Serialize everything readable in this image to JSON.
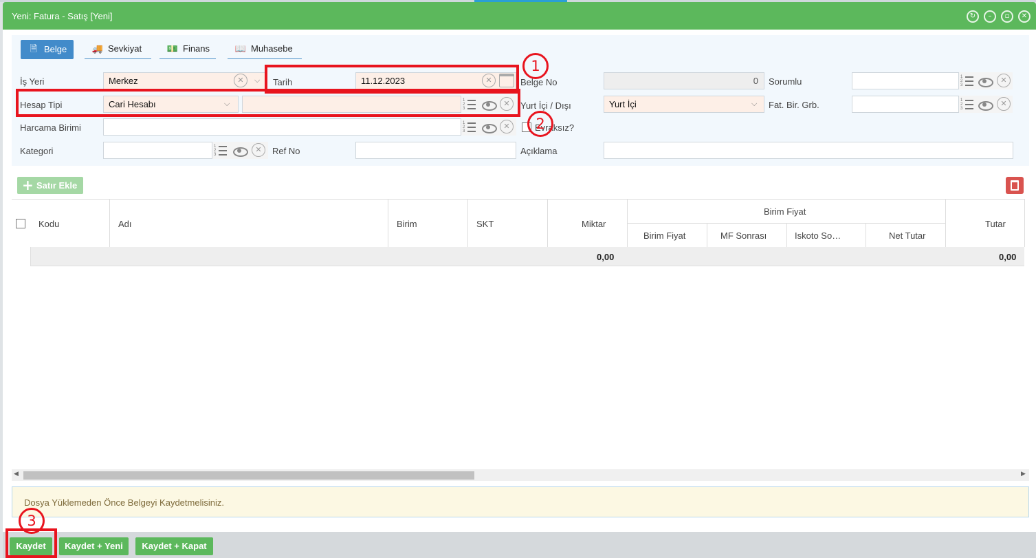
{
  "window": {
    "title": "Yeni: Fatura - Satış [Yeni]"
  },
  "tabs": [
    {
      "label": "Belge",
      "icon": "document-icon",
      "active": true
    },
    {
      "label": "Sevkiyat",
      "icon": "truck-icon"
    },
    {
      "label": "Finans",
      "icon": "money-icon"
    },
    {
      "label": "Muhasebe",
      "icon": "book-icon"
    }
  ],
  "form": {
    "is_yeri": {
      "label": "İş Yeri",
      "value": "Merkez"
    },
    "tarih": {
      "label": "Tarih",
      "value": "11.12.2023"
    },
    "belge_no": {
      "label": "Belge No",
      "value": "0"
    },
    "sorumlu": {
      "label": "Sorumlu",
      "value": ""
    },
    "hesap_tipi": {
      "label": "Hesap Tipi",
      "value": "Cari Hesabı"
    },
    "hesap": {
      "value": ""
    },
    "yurt": {
      "label": "Yurt İçi / Dışı",
      "value": "Yurt İçi"
    },
    "fat_bir_grb": {
      "label": "Fat. Bir. Grb.",
      "value": ""
    },
    "harcama_birimi": {
      "label": "Harcama Birimi",
      "value": ""
    },
    "evraksiz": {
      "label": "Evraksız?",
      "checked": false
    },
    "kategori": {
      "label": "Kategori",
      "value": ""
    },
    "ref_no": {
      "label": "Ref No",
      "value": ""
    },
    "aciklama": {
      "label": "Açıklama",
      "value": ""
    }
  },
  "grid": {
    "add_row_label": "Satır Ekle",
    "columns": {
      "kodu": "Kodu",
      "adi": "Adı",
      "birim": "Birim",
      "skt": "SKT",
      "miktar": "Miktar",
      "birim_fiyat_group": "Birim Fiyat",
      "birim_fiyat": "Birim Fiyat",
      "mf_sonrasi": "MF Sonrası",
      "iskoto": "Iskoto So…",
      "net_tutar": "Net Tutar",
      "tutar": "Tutar"
    },
    "totals": {
      "miktar": "0,00",
      "tutar": "0,00"
    }
  },
  "warning": "Dosya Yüklemeden Önce Belgeyi Kaydetmelisiniz.",
  "buttons": {
    "kaydet": "Kaydet",
    "kaydet_yeni": "Kaydet + Yeni",
    "kaydet_kapat": "Kaydet + Kapat"
  },
  "annotations": {
    "n1": "1",
    "n2": "2",
    "n3": "3"
  },
  "colors": {
    "header_green": "#5cb85c",
    "tab_blue": "#428bca",
    "annotation_red": "#e8141e",
    "required_bg": "#fdefe7"
  }
}
